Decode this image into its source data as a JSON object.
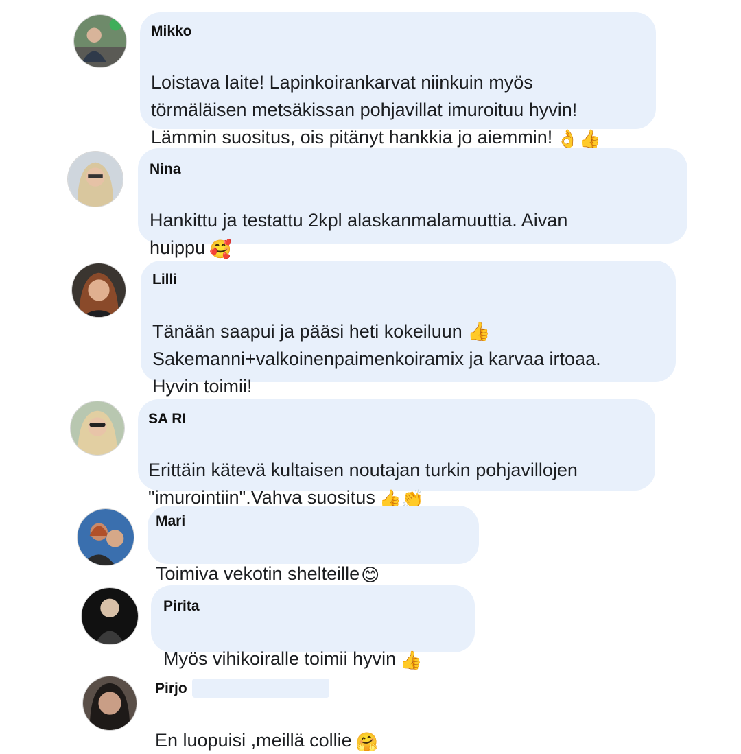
{
  "comments": [
    {
      "name": "Mikko",
      "avatar_icon": "user-avatar",
      "text": "Loistava laite! Lapinkoirankarvat niinkuin myös\ntörmäläisen metsäkissan pohjavillat imuroituu hyvin!\nLämmin suositus, ois pitänyt hankkia jo aiemmin!",
      "emoji": "👌👍"
    },
    {
      "name": "Nina",
      "avatar_icon": "user-avatar",
      "text": "Hankittu ja testattu 2kpl alaskanmalamuuttia. Aivan\nhuippu",
      "emoji": "🥰"
    },
    {
      "name": "Lilli",
      "avatar_icon": "user-avatar",
      "text": "Tänään saapui ja pääsi heti kokeiluun 👍\nSakemanni+valkoinenpaimenkoiramix ja karvaa irtoaa.\nHyvin toimii!",
      "emoji": ""
    },
    {
      "name": "SA RI",
      "avatar_icon": "user-avatar",
      "text": "Erittäin kätevä kultaisen noutajan turkin pohjavillojen\n\"imurointiin\".Vahva suositus",
      "emoji": "👍👏"
    },
    {
      "name": "Mari",
      "avatar_icon": "user-avatar",
      "text": "Toimiva vekotin shelteille",
      "emoji": "😊"
    },
    {
      "name": "Pirita",
      "avatar_icon": "user-avatar",
      "text": "Myös vihikoiralle toimii hyvin",
      "emoji": "👍"
    },
    {
      "name": "Pirjo",
      "avatar_icon": "user-avatar",
      "text": "En luopuisi ,meillä collie",
      "emoji": "🤗"
    }
  ]
}
